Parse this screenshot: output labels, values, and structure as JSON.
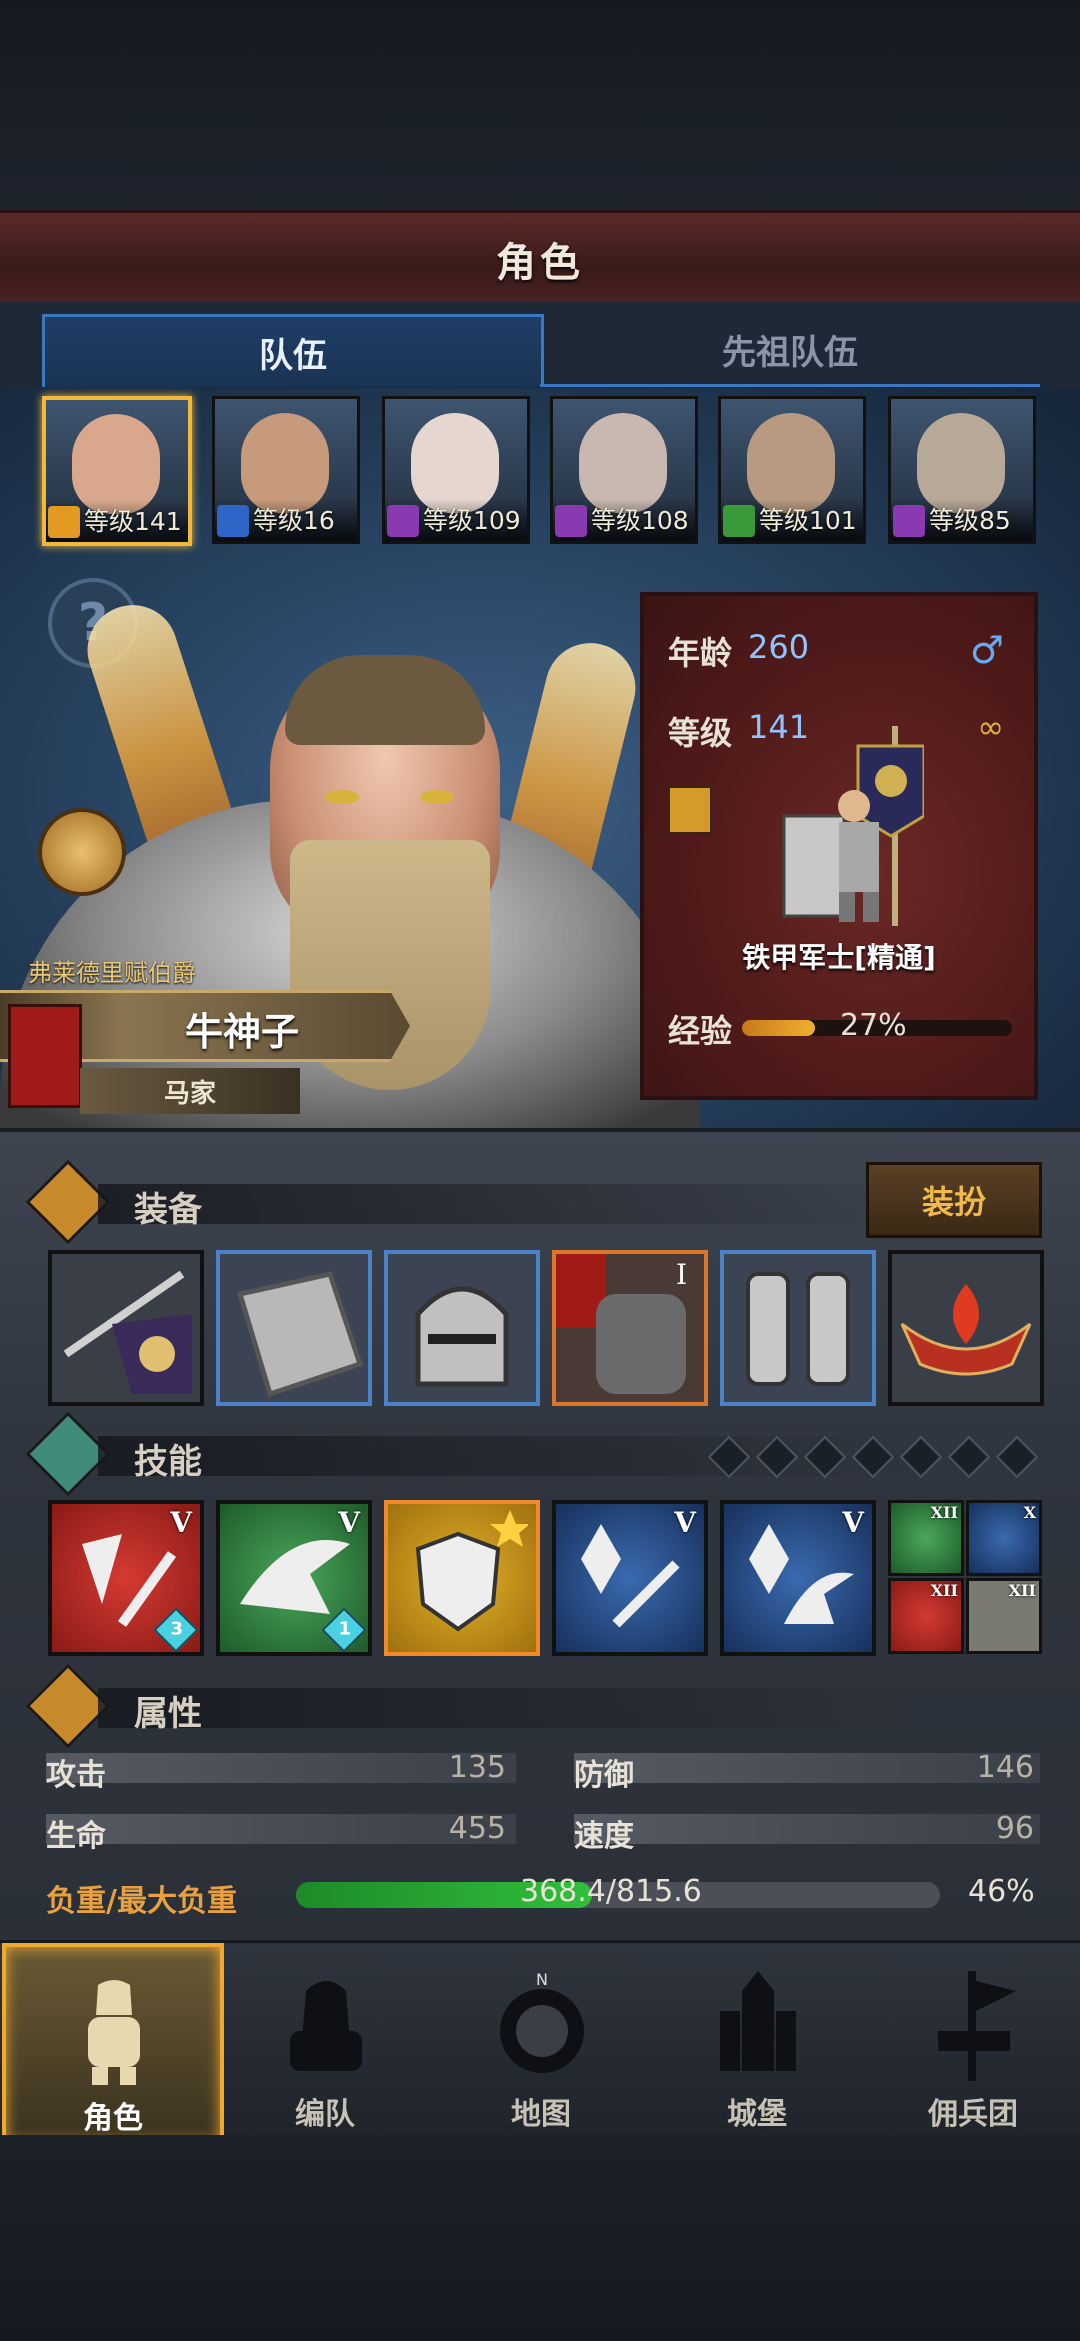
{
  "header": {
    "title": "角色"
  },
  "tabs": [
    {
      "label": "队伍"
    },
    {
      "label": "先祖队伍"
    }
  ],
  "roster": [
    {
      "level_text": "等级141",
      "class_color": "#e39a22",
      "face_color": "#d9a88c"
    },
    {
      "level_text": "等级16",
      "class_color": "#2e66c8",
      "face_color": "#c79a7c"
    },
    {
      "level_text": "等级109",
      "class_color": "#8a3ab0",
      "face_color": "#e6d6d0"
    },
    {
      "level_text": "等级108",
      "class_color": "#8a3ab0",
      "face_color": "#c8b8b0"
    },
    {
      "level_text": "等级101",
      "class_color": "#3a9a3a",
      "face_color": "#b89a80"
    },
    {
      "level_text": "等级85",
      "class_color": "#8a3ab0",
      "face_color": "#b8a898"
    }
  ],
  "character": {
    "noble_title": "弗莱德里赋伯爵",
    "name": "牛神子",
    "family": "马家",
    "age_label": "年龄",
    "age": "260",
    "level_label": "等级",
    "level": "141",
    "class_name": "铁甲军士[精通]",
    "exp_label": "经验",
    "exp_percent": "27%",
    "exp_fraction": 0.27,
    "gender_icon": "♂",
    "ring_icon": "∞"
  },
  "equipment": {
    "section_title": "装备",
    "outfit_button": "装扮",
    "slots": [
      "banner",
      "shield",
      "helmet",
      "armor",
      "greaves",
      "emblem"
    ]
  },
  "skills": {
    "section_title": "技能",
    "items": [
      {
        "rank": "V",
        "badge": "3"
      },
      {
        "rank": "V",
        "badge": "1"
      },
      {
        "rank": "",
        "badge": ""
      },
      {
        "rank": "V",
        "badge": ""
      },
      {
        "rank": "V",
        "badge": ""
      }
    ],
    "mini": [
      {
        "rank": "XII"
      },
      {
        "rank": "X"
      },
      {
        "rank": "XII"
      },
      {
        "rank": "XII"
      }
    ]
  },
  "attributes": {
    "section_title": "属性",
    "attack_label": "攻击",
    "attack": "135",
    "defense_label": "防御",
    "defense": "146",
    "hp_label": "生命",
    "hp": "455",
    "speed_label": "速度",
    "speed": "96",
    "load_label": "负重/最大负重",
    "load": "368.4/815.6",
    "load_percent": "46%",
    "load_fraction": 0.46
  },
  "nav": [
    {
      "label": "角色",
      "active": true
    },
    {
      "label": "编队"
    },
    {
      "label": "地图"
    },
    {
      "label": "城堡"
    },
    {
      "label": "佣兵团"
    }
  ]
}
